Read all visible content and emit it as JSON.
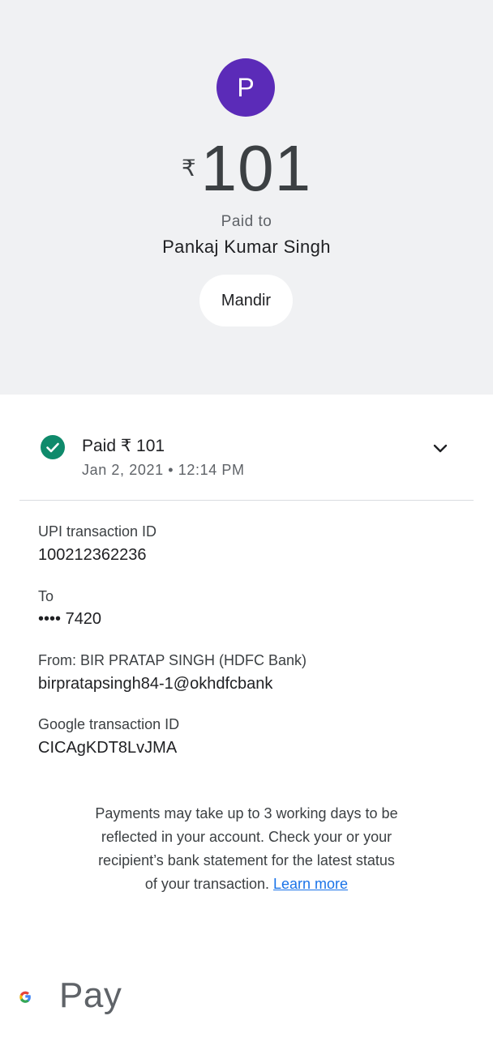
{
  "header": {
    "avatar_letter": "P",
    "currency_symbol": "₹",
    "amount": "101",
    "paid_to_label": "Paid to",
    "payee_name": "Pankaj Kumar Singh",
    "note": "Mandir"
  },
  "status": {
    "title": "Paid ₹ 101",
    "datetime": "Jan 2, 2021 • 12:14 PM",
    "icon": "check-circle-icon",
    "expand_icon": "chevron-down-icon"
  },
  "details": {
    "upi_label": "UPI transaction ID",
    "upi_value": "100212362236",
    "to_label": "To",
    "to_value": "•••• 7420",
    "from_label": "From: BIR PRATAP SINGH (HDFC Bank)",
    "from_value": "birpratapsingh84-1@okhdfcbank",
    "google_label": "Google transaction ID",
    "google_value": "CICAgKDT8LvJMA"
  },
  "footer": {
    "info_line1": "Payments may take up to 3 working days to be",
    "info_line2": "reflected in your account. Check your or your",
    "info_line3": "recipient’s bank statement for the latest status",
    "info_line4": "of your transaction.",
    "learn_more": "Learn more",
    "brand": "Pay"
  },
  "colors": {
    "header_bg": "#f0f1f3",
    "avatar_bg": "#5b2bb8",
    "success_green": "#0f8a6b",
    "link_blue": "#1a73e8"
  }
}
